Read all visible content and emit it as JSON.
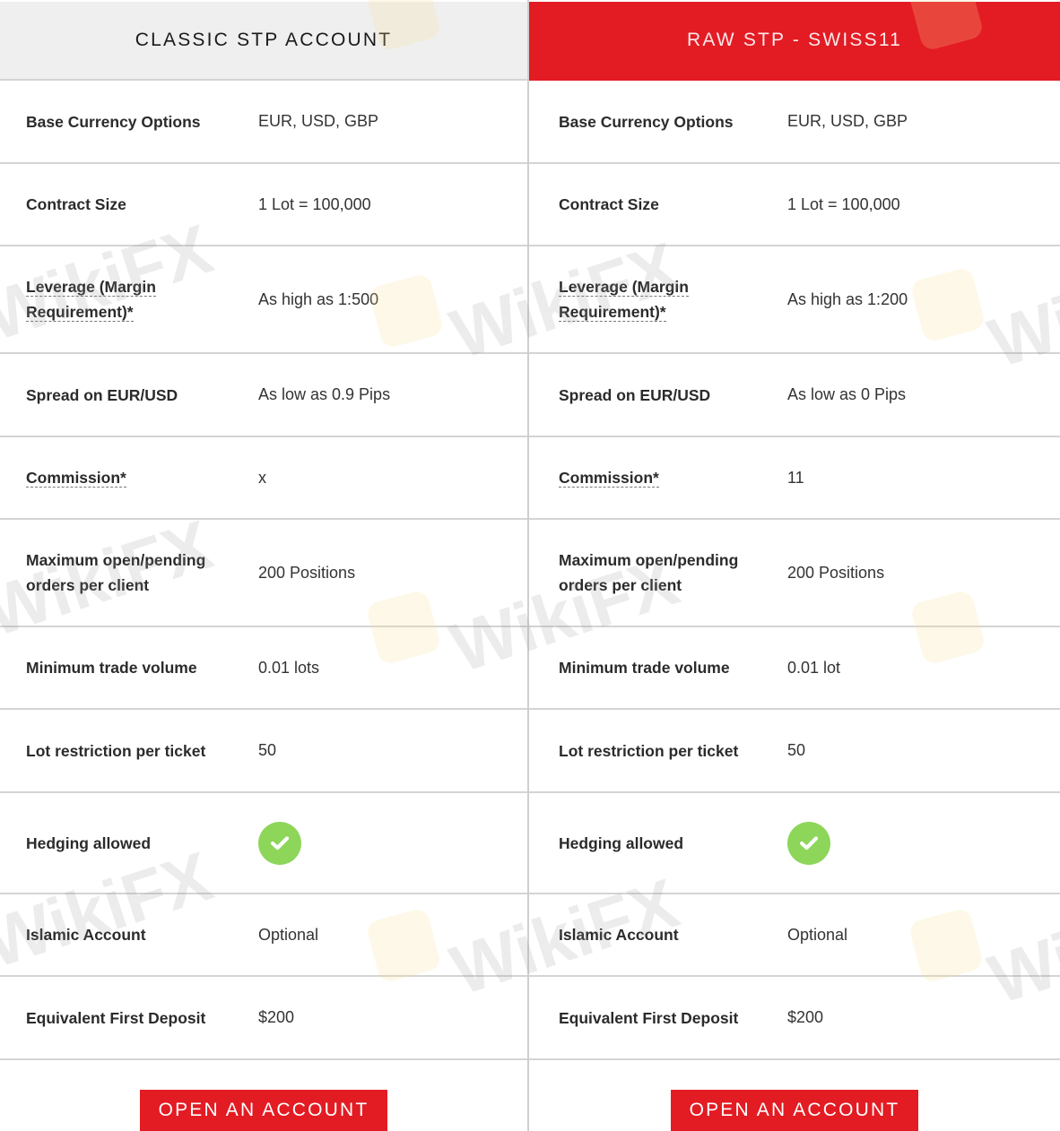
{
  "colors": {
    "accent": "#e31b23",
    "header_gray": "#efefef",
    "check_green": "#8dd65a"
  },
  "watermark": "WikiFX",
  "accounts": [
    {
      "title": "CLASSIC STP ACCOUNT",
      "rows": [
        {
          "label": "Base Currency Options",
          "value": "EUR, USD, GBP"
        },
        {
          "label": "Contract Size",
          "value": "1 Lot = 100,000"
        },
        {
          "label": "Leverage (Margin Requirement)*",
          "value": "As high as 1:500"
        },
        {
          "label": "Spread on EUR/USD",
          "value": "As low as 0.9 Pips"
        },
        {
          "label": "Commission*",
          "value": "x"
        },
        {
          "label": "Maximum open/pending orders per client",
          "value": "200 Positions"
        },
        {
          "label": "Minimum trade volume",
          "value": "0.01 lots"
        },
        {
          "label": "Lot restriction per ticket",
          "value": "50"
        },
        {
          "label": "Hedging allowed",
          "value": "check-icon"
        },
        {
          "label": "Islamic Account",
          "value": "Optional"
        },
        {
          "label": "Equivalent First Deposit",
          "value": "$200"
        }
      ],
      "button_label": "OPEN AN ACCOUNT"
    },
    {
      "title": "RAW STP - SWISS11",
      "rows": [
        {
          "label": "Base Currency Options",
          "value": "EUR, USD, GBP"
        },
        {
          "label": "Contract Size",
          "value": "1 Lot = 100,000"
        },
        {
          "label": "Leverage (Margin Requirement)*",
          "value": "As high as 1:200"
        },
        {
          "label": "Spread on EUR/USD",
          "value": "As low as 0 Pips"
        },
        {
          "label": "Commission*",
          "value": "11"
        },
        {
          "label": "Maximum open/pending orders per client",
          "value": "200 Positions"
        },
        {
          "label": "Minimum trade volume",
          "value": "0.01 lot"
        },
        {
          "label": "Lot restriction per ticket",
          "value": "50"
        },
        {
          "label": "Hedging allowed",
          "value": "check-icon"
        },
        {
          "label": "Islamic Account",
          "value": "Optional"
        },
        {
          "label": "Equivalent First Deposit",
          "value": "$200"
        }
      ],
      "button_label": "OPEN AN ACCOUNT"
    }
  ]
}
